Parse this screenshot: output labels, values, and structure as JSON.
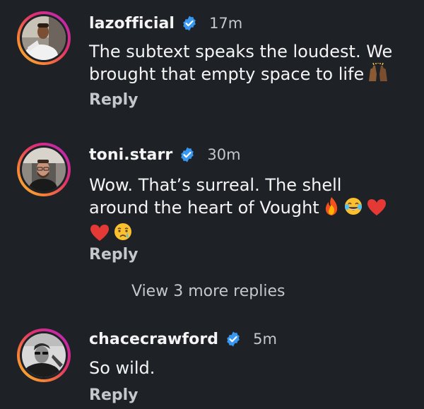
{
  "comments": [
    {
      "username": "lazofficial",
      "time": "17m",
      "text_lines": [
        "The subtext speaks the loudest. We",
        "brought that empty space to life"
      ],
      "emojis": [
        "raised-hands-emoji"
      ],
      "reply_label": "Reply",
      "verified": true
    },
    {
      "username": "toni.starr",
      "time": "30m",
      "text_lines": [
        "Wow. That’s surreal. The shell",
        "around the heart of Vought"
      ],
      "emojis": [
        "fire-emoji",
        "tears-of-joy-emoji",
        "red-heart-emoji",
        "red-heart-emoji",
        "crying-face-emoji"
      ],
      "reply_label": "Reply",
      "verified": true
    },
    {
      "username": "chacecrawford",
      "time": "5m",
      "text_lines": [
        "So wild."
      ],
      "emojis": [],
      "reply_label": "Reply",
      "verified": true
    }
  ],
  "view_more_replies": "View 3 more replies",
  "colors": {
    "background": "#1e2227",
    "verified_badge": "#3897f0",
    "secondary_text": "#c4c7cc",
    "primary_text": "#f4f4f4"
  }
}
